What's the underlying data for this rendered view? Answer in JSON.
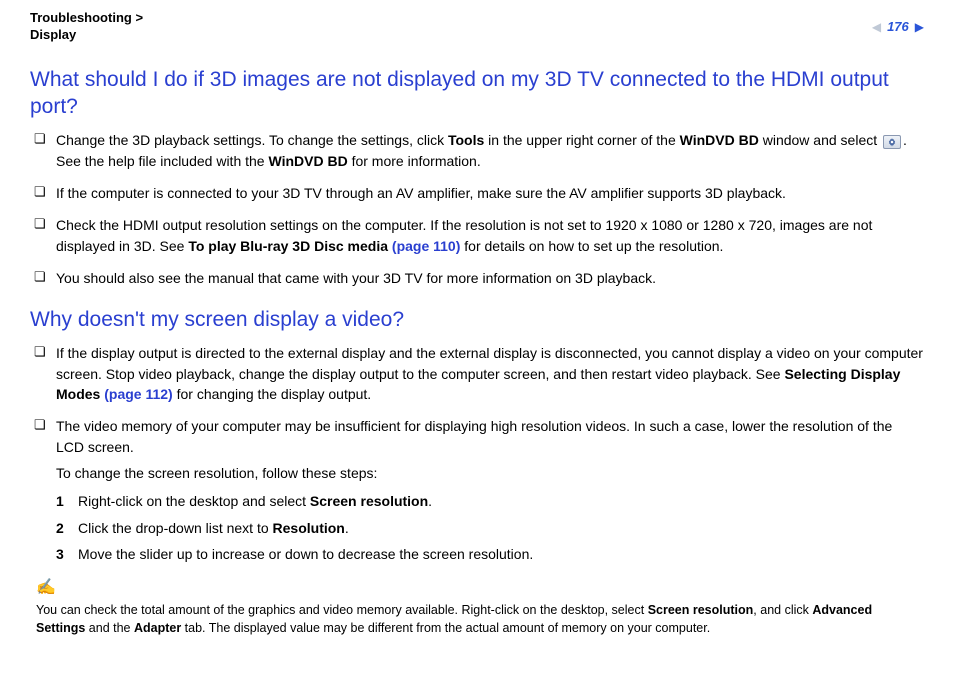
{
  "header": {
    "breadcrumb1": "Troubleshooting",
    "sep": ">",
    "breadcrumb2": "Display",
    "page_number": "176"
  },
  "section1": {
    "title": "What should I do if 3D images are not displayed on my 3D TV connected to the HDMI output port?",
    "b1_a": "Change the 3D playback settings. To change the settings, click ",
    "b1_tools": "Tools",
    "b1_b": " in the upper right corner of the ",
    "b1_app": "WinDVD BD",
    "b1_c": " window and select ",
    "b1_d": ". See the help file included with the ",
    "b1_app2": "WinDVD BD",
    "b1_e": " for more information.",
    "b2": "If the computer is connected to your 3D TV through an AV amplifier, make sure the AV amplifier supports 3D playback.",
    "b3_a": "Check the HDMI output resolution settings on the computer. If the resolution is not set to 1920 x 1080 or 1280 x 720, images are not displayed in 3D. See ",
    "b3_see": "To play Blu-ray 3D Disc media",
    "b3_link": " (page 110)",
    "b3_b": " for details on how to set up the resolution.",
    "b4": "You should also see the manual that came with your 3D TV for more information on 3D playback."
  },
  "section2": {
    "title": "Why doesn't my screen display a video?",
    "b1_a": "If the display output is directed to the external display and the external display is disconnected, you cannot display a video on your computer screen. Stop video playback, change the display output to the computer screen, and then restart video playback. See ",
    "b1_see": "Selecting Display Modes",
    "b1_link": " (page 112)",
    "b1_b": " for changing the display output.",
    "b2": "The video memory of your computer may be insufficient for displaying high resolution videos. In such a case, lower the resolution of the LCD screen.",
    "b2_sub": "To change the screen resolution, follow these steps:",
    "s1_a": "Right-click on the desktop and select ",
    "s1_b": "Screen resolution",
    "s1_c": ".",
    "s2_a": "Click the drop-down list next to ",
    "s2_b": "Resolution",
    "s2_c": ".",
    "s3": "Move the slider up to increase or down to decrease the screen resolution.",
    "note_a": "You can check the total amount of the graphics and video memory available. Right-click on the desktop, select ",
    "note_b": "Screen resolution",
    "note_c": ", and click ",
    "note_d": "Advanced Settings",
    "note_e": " and the ",
    "note_f": "Adapter",
    "note_g": " tab. The displayed value may be different from the actual amount of memory on your computer."
  },
  "nums": {
    "n1": "1",
    "n2": "2",
    "n3": "3"
  }
}
